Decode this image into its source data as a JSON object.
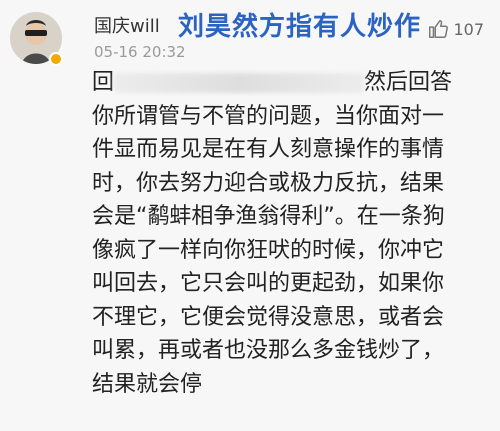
{
  "post": {
    "username": "国庆will",
    "timestamp": "05-16 20:32",
    "headline": "刘昊然方指有人炒作",
    "like_count": "107",
    "icons": {
      "avatar": "user-avatar",
      "verified": "verified-badge-icon",
      "like": "thumbs-up-icon"
    },
    "colors": {
      "headline": "#2b63c2",
      "verified": "#f2a900"
    },
    "comment_lines": [
      "然后回答",
      "你所谓管与不管的问题，当你面对一",
      "件显而易见是在有人刻意操作的事情",
      "时，你去努力迎合或极力反抗，结果",
      "会是“鹬蚌相争渔翁得利”。在一条狗",
      "像疯了一样向你狂吠的时候，你冲它",
      "叫回去，它只会叫的更起劲，如果你",
      "不理它，它便会觉得没意思，或者会",
      "叫累，再或者也没那么多金钱炒了，",
      "结果就会停"
    ],
    "comment_first_prefix": "回"
  }
}
